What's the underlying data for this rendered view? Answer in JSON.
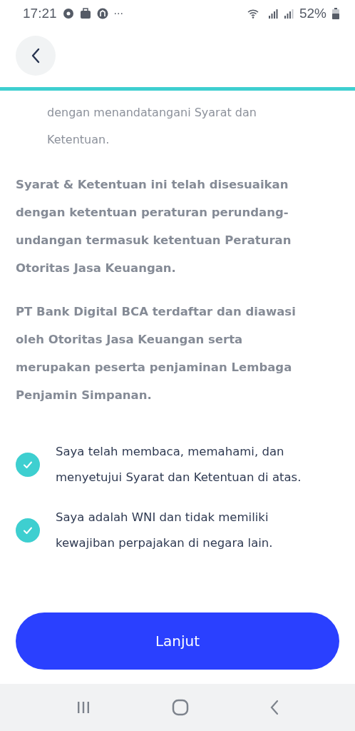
{
  "status_bar": {
    "time": "17:21",
    "more": "···",
    "battery": "52%"
  },
  "intro_tail": "dengan menandatangani Syarat dan Ketentuan.",
  "paragraphs": [
    "Syarat & Ketentuan ini telah disesuaikan dengan ketentuan peraturan perundang-undangan termasuk ketentuan Peraturan Otoritas Jasa Keuangan.",
    "PT Bank Digital BCA terdaftar dan diawasi oleh Otoritas Jasa Keuangan serta merupakan peserta penjaminan Lembaga Penjamin Simpanan."
  ],
  "agreements": [
    {
      "label": "Saya telah membaca, memahami, dan menyetujui Syarat dan Ketentuan di atas.",
      "checked": true
    },
    {
      "label": "Saya adalah WNI dan tidak memiliki kewajiban perpajakan di negara lain.",
      "checked": true
    }
  ],
  "button": "Lanjut"
}
